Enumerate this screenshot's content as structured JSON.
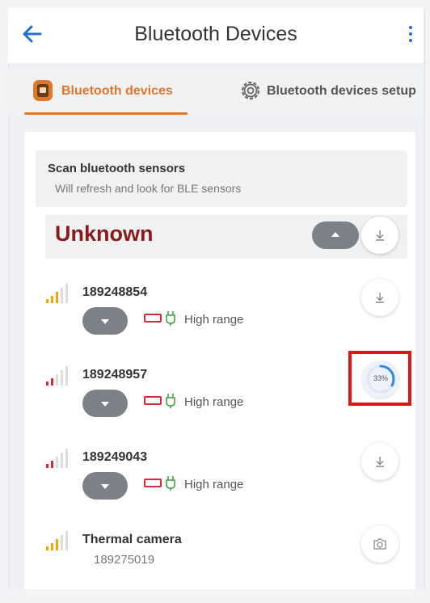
{
  "header": {
    "title": "Bluetooth Devices",
    "back_icon": "arrow-left-icon",
    "menu_icon": "more-vert-icon",
    "accent_color": "#1f6fd6"
  },
  "tabs": [
    {
      "label": "Bluetooth devices",
      "icon": "device-icon",
      "active": true,
      "color": "#e0762a"
    },
    {
      "label": "Bluetooth devices setup",
      "icon": "gear-icon",
      "active": false
    }
  ],
  "scan": {
    "title": "Scan bluetooth sensors",
    "subtitle": "Will refresh and look for BLE sensors"
  },
  "group": {
    "label": "Unknown",
    "label_color": "#8b1a1a",
    "toggle_icon": "chevron-up-icon",
    "action_icon": "download-icon"
  },
  "devices": [
    {
      "name": "189248854",
      "signal_color": "#f2a400",
      "range": "High range",
      "action_icon": "download-icon"
    },
    {
      "name": "189248957",
      "signal_color": "#d62a3a",
      "range": "High range",
      "action_icon": "progress-ring",
      "progress_label": "33%",
      "progress": 0.33
    },
    {
      "name": "189249043",
      "signal_color": "#d62a3a",
      "range": "High range",
      "action_icon": "download-icon"
    },
    {
      "name": "Thermal camera",
      "serial": "189275019",
      "signal_color": "#f2a400",
      "action_icon": "camera-icon"
    }
  ],
  "colors": {
    "battery": "#d62a3a",
    "charging": "#3aa63a",
    "highlight": "#e01515",
    "pill": "#7c8087"
  }
}
